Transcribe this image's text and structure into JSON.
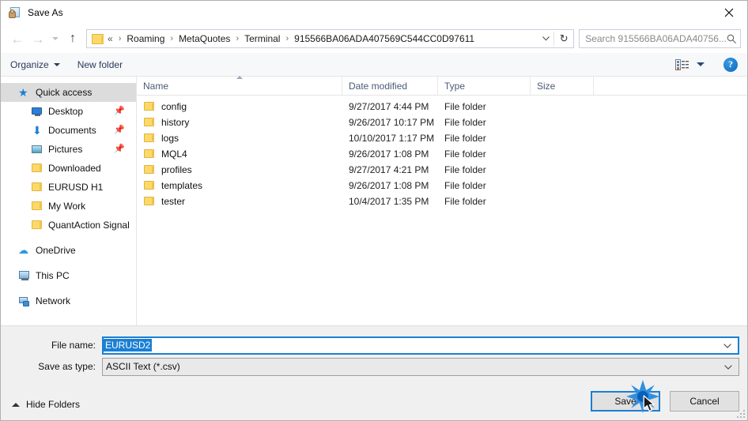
{
  "window": {
    "title": "Save As",
    "title_icon": "save-as-icon",
    "close_icon": "close-icon"
  },
  "nav": {
    "back_icon": "arrow-left-icon",
    "forward_icon": "arrow-right-icon",
    "history_icon": "chevron-down-icon",
    "up_icon": "arrow-up-icon",
    "breadcrumb_folder_icon": "folder-icon",
    "breadcrumb_prefix": "«",
    "breadcrumbs": [
      "Roaming",
      "MetaQuotes",
      "Terminal",
      "915566BA06ADA407569C544CC0D97611"
    ],
    "breadcrumb_separator": "›",
    "address_dropdown_icon": "chevron-down-icon",
    "refresh_icon": "refresh-icon",
    "refresh_glyph": "↻"
  },
  "search": {
    "placeholder": "Search 915566BA06ADA40756...",
    "icon": "search-icon"
  },
  "toolbar": {
    "organize_label": "Organize",
    "new_folder_label": "New folder",
    "view_icon": "list-view-icon",
    "view_dropdown_icon": "chevron-down-icon",
    "help_label": "?",
    "help_icon": "help-icon"
  },
  "sidebar": {
    "items": [
      {
        "label": "Quick access",
        "icon": "star-icon",
        "level": 0,
        "selected": true,
        "pinned": false
      },
      {
        "label": "Desktop",
        "icon": "monitor-icon",
        "level": 1,
        "selected": false,
        "pinned": true
      },
      {
        "label": "Documents",
        "icon": "download-arrow-icon",
        "level": 1,
        "selected": false,
        "pinned": true
      },
      {
        "label": "Pictures",
        "icon": "picture-icon",
        "level": 1,
        "selected": false,
        "pinned": true
      },
      {
        "label": "Downloaded",
        "icon": "folder-icon",
        "level": 1,
        "selected": false,
        "pinned": false
      },
      {
        "label": "EURUSD H1",
        "icon": "folder-icon",
        "level": 1,
        "selected": false,
        "pinned": false
      },
      {
        "label": "My Work",
        "icon": "folder-icon",
        "level": 1,
        "selected": false,
        "pinned": false
      },
      {
        "label": "QuantAction Signal",
        "icon": "folder-icon",
        "level": 1,
        "selected": false,
        "pinned": false
      },
      {
        "label": "OneDrive",
        "icon": "cloud-icon",
        "level": 0,
        "selected": false,
        "pinned": false
      },
      {
        "label": "This PC",
        "icon": "pc-icon",
        "level": 0,
        "selected": false,
        "pinned": false
      },
      {
        "label": "Network",
        "icon": "network-icon",
        "level": 0,
        "selected": false,
        "pinned": false
      }
    ],
    "pin_glyph": "📌"
  },
  "filelist": {
    "columns": [
      "Name",
      "Date modified",
      "Type",
      "Size"
    ],
    "sort_column": "Name",
    "sort_direction": "ascending",
    "rows": [
      {
        "name": "config",
        "date": "9/27/2017 4:44 PM",
        "type": "File folder",
        "size": "",
        "icon": "folder-icon"
      },
      {
        "name": "history",
        "date": "9/26/2017 10:17 PM",
        "type": "File folder",
        "size": "",
        "icon": "folder-icon"
      },
      {
        "name": "logs",
        "date": "10/10/2017 1:17 PM",
        "type": "File folder",
        "size": "",
        "icon": "folder-icon"
      },
      {
        "name": "MQL4",
        "date": "9/26/2017 1:08 PM",
        "type": "File folder",
        "size": "",
        "icon": "folder-icon"
      },
      {
        "name": "profiles",
        "date": "9/27/2017 4:21 PM",
        "type": "File folder",
        "size": "",
        "icon": "folder-icon"
      },
      {
        "name": "templates",
        "date": "9/26/2017 1:08 PM",
        "type": "File folder",
        "size": "",
        "icon": "folder-icon"
      },
      {
        "name": "tester",
        "date": "10/4/2017 1:35 PM",
        "type": "File folder",
        "size": "",
        "icon": "folder-icon"
      }
    ]
  },
  "form": {
    "filename_label": "File name:",
    "filename_value": "EURUSD2",
    "filename_dropdown_icon": "chevron-down-icon",
    "filetype_label": "Save as type:",
    "filetype_value": "ASCII Text (*.csv)",
    "filetype_dropdown_icon": "chevron-down-icon"
  },
  "footer": {
    "hide_folders_label": "Hide Folders",
    "hide_folders_icon": "chevron-up-icon",
    "save_label": "Save",
    "cancel_label": "Cancel",
    "resize_grip_icon": "resize-grip-icon"
  },
  "pointer": {
    "cursor_icon": "mouse-cursor",
    "click_burst_icon": "click-burst-icon",
    "burst_color": "#1a7fd4"
  },
  "colors": {
    "accent": "#1a7fd4",
    "folder": "#fdd96a",
    "selection": "#dcdcdc",
    "footer_bg": "#f0f0f0",
    "toolbar_bg": "#f7f8fa",
    "header_text": "#4a5a78"
  }
}
